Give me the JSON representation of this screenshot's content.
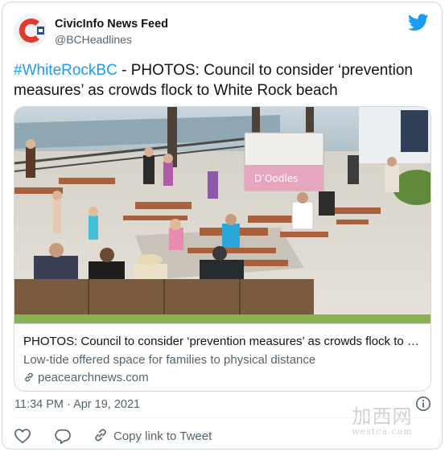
{
  "author": {
    "name": "CivicInfo News Feed",
    "handle": "@BCHeadlines"
  },
  "tweet": {
    "hashtag": "#WhiteRockBC",
    "text": " - PHOTOS: Council to consider ‘prevention measures’ as crowds flock to White Rock beach"
  },
  "link_card": {
    "title": "PHOTOS: Council to consider ‘prevention measures’ as crowds flock to W...",
    "description": "Low-tide offered space for families to physical distance",
    "domain": "peacearchnews.com",
    "food_truck_sign": "D’Oodles"
  },
  "timestamp": "11:34 PM · Apr 19, 2021",
  "actions": {
    "copy_link_label": "Copy link to Tweet"
  },
  "watermark": {
    "cn": "加西网",
    "en": "westca.com"
  },
  "colors": {
    "twitter_blue": "#1d9bf0",
    "secondary_text": "#536471",
    "border": "#cfd9de",
    "brand_red": "#e0392f"
  },
  "icons": [
    "civicinfo-logo-icon",
    "twitter-bird-icon",
    "link-icon",
    "info-icon",
    "like-heart-icon",
    "reply-bubble-icon",
    "copy-link-icon"
  ]
}
